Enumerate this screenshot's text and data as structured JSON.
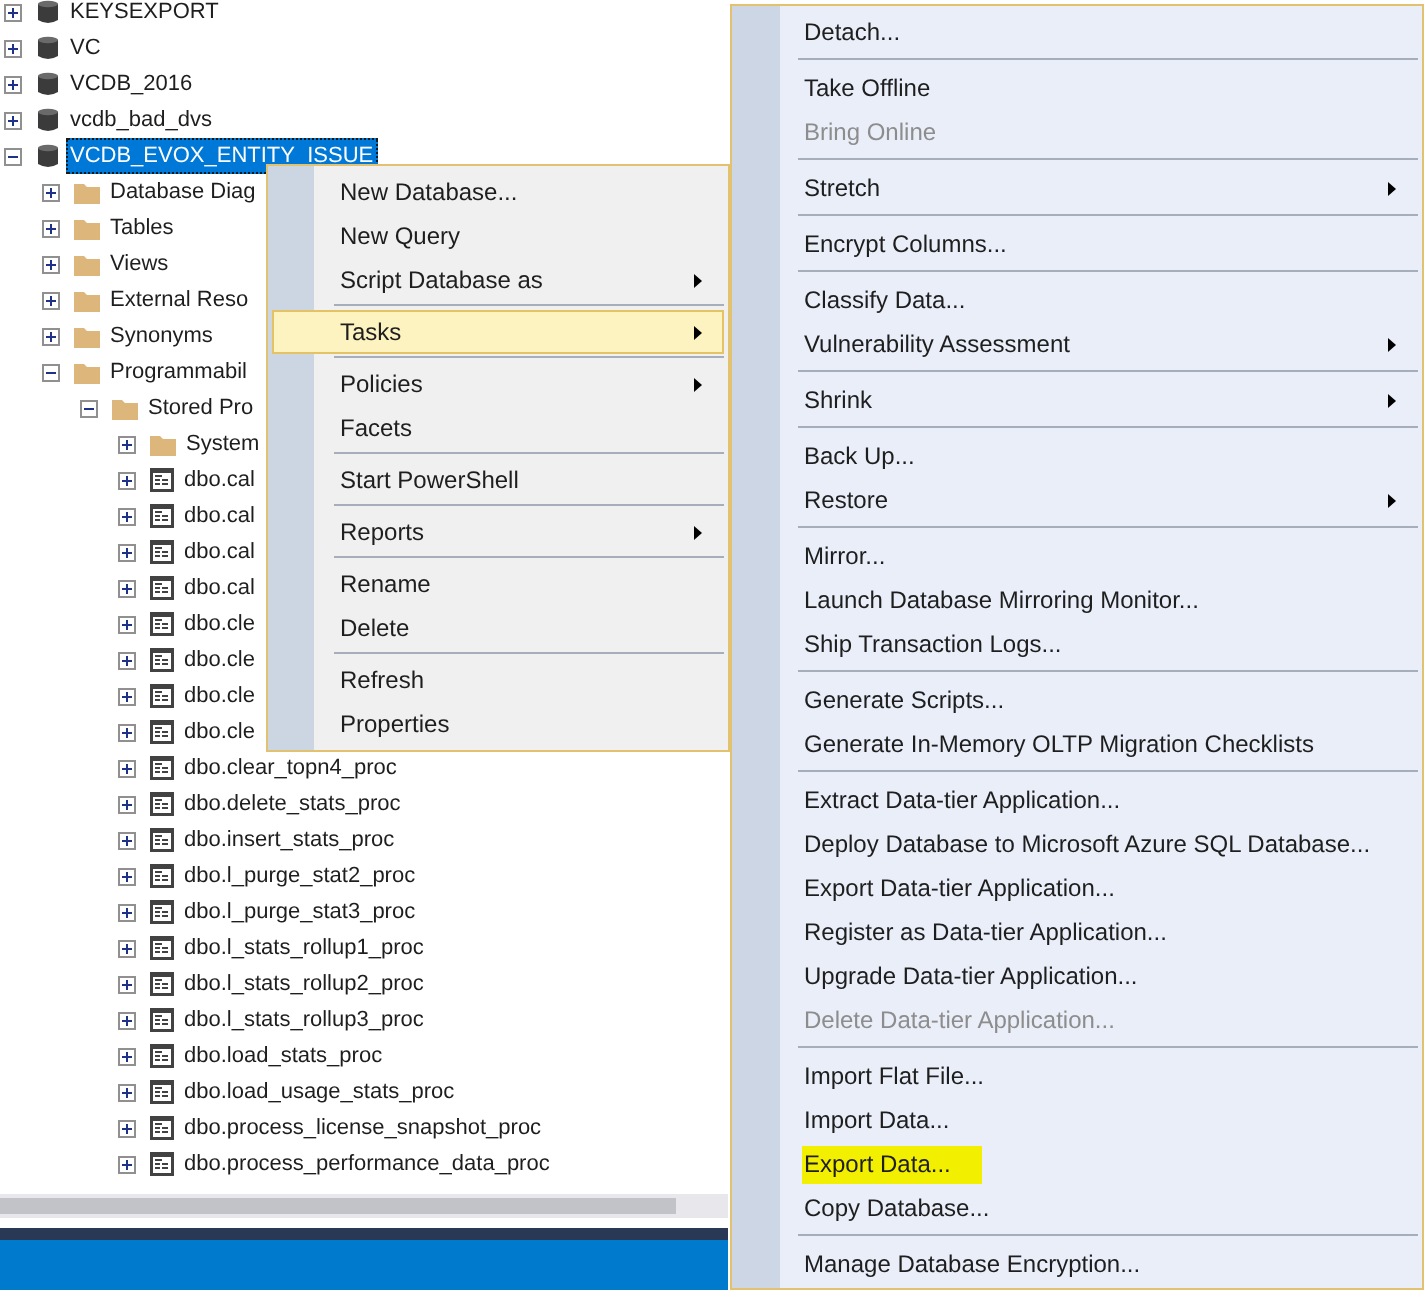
{
  "object_explorer": {
    "tree": [
      {
        "label": "KEYSEXPORT",
        "kind": "database",
        "expanded": false,
        "selected": false
      },
      {
        "label": "VC",
        "kind": "database",
        "expanded": false,
        "selected": false
      },
      {
        "label": "VCDB_2016",
        "kind": "database",
        "expanded": false,
        "selected": false
      },
      {
        "label": "vcdb_bad_dvs",
        "kind": "database",
        "expanded": false,
        "selected": false
      },
      {
        "label": "VCDB_EVOX_ENTITY_ISSUE",
        "kind": "database",
        "expanded": true,
        "selected": true,
        "children": [
          {
            "label": "Database Diag",
            "kind": "folder",
            "expanded": false,
            "selected": false
          },
          {
            "label": "Tables",
            "kind": "folder",
            "expanded": false,
            "selected": false
          },
          {
            "label": "Views",
            "kind": "folder",
            "expanded": false,
            "selected": false
          },
          {
            "label": "External Reso",
            "kind": "folder",
            "expanded": false,
            "selected": false
          },
          {
            "label": "Synonyms",
            "kind": "folder",
            "expanded": false,
            "selected": false
          },
          {
            "label": "Programmabil",
            "kind": "folder",
            "expanded": true,
            "selected": false,
            "children": [
              {
                "label": "Stored Pro",
                "kind": "folder",
                "expanded": true,
                "selected": false,
                "children": [
                  {
                    "label": "System",
                    "kind": "folder",
                    "expanded": false,
                    "selected": false
                  },
                  {
                    "label": "dbo.cal",
                    "kind": "procedure",
                    "expanded": false,
                    "selected": false
                  },
                  {
                    "label": "dbo.cal",
                    "kind": "procedure",
                    "expanded": false,
                    "selected": false
                  },
                  {
                    "label": "dbo.cal",
                    "kind": "procedure",
                    "expanded": false,
                    "selected": false
                  },
                  {
                    "label": "dbo.cal",
                    "kind": "procedure",
                    "expanded": false,
                    "selected": false
                  },
                  {
                    "label": "dbo.cle",
                    "kind": "procedure",
                    "expanded": false,
                    "selected": false
                  },
                  {
                    "label": "dbo.cle",
                    "kind": "procedure",
                    "expanded": false,
                    "selected": false
                  },
                  {
                    "label": "dbo.cle",
                    "kind": "procedure",
                    "expanded": false,
                    "selected": false
                  },
                  {
                    "label": "dbo.cle",
                    "kind": "procedure",
                    "expanded": false,
                    "selected": false
                  },
                  {
                    "label": "dbo.clear_topn4_proc",
                    "kind": "procedure",
                    "expanded": false,
                    "selected": false
                  },
                  {
                    "label": "dbo.delete_stats_proc",
                    "kind": "procedure",
                    "expanded": false,
                    "selected": false
                  },
                  {
                    "label": "dbo.insert_stats_proc",
                    "kind": "procedure",
                    "expanded": false,
                    "selected": false
                  },
                  {
                    "label": "dbo.l_purge_stat2_proc",
                    "kind": "procedure",
                    "expanded": false,
                    "selected": false
                  },
                  {
                    "label": "dbo.l_purge_stat3_proc",
                    "kind": "procedure",
                    "expanded": false,
                    "selected": false
                  },
                  {
                    "label": "dbo.l_stats_rollup1_proc",
                    "kind": "procedure",
                    "expanded": false,
                    "selected": false
                  },
                  {
                    "label": "dbo.l_stats_rollup2_proc",
                    "kind": "procedure",
                    "expanded": false,
                    "selected": false
                  },
                  {
                    "label": "dbo.l_stats_rollup3_proc",
                    "kind": "procedure",
                    "expanded": false,
                    "selected": false
                  },
                  {
                    "label": "dbo.load_stats_proc",
                    "kind": "procedure",
                    "expanded": false,
                    "selected": false
                  },
                  {
                    "label": "dbo.load_usage_stats_proc",
                    "kind": "procedure",
                    "expanded": false,
                    "selected": false
                  },
                  {
                    "label": "dbo.process_license_snapshot_proc",
                    "kind": "procedure",
                    "expanded": false,
                    "selected": false
                  },
                  {
                    "label": "dbo.process_performance_data_proc",
                    "kind": "procedure",
                    "expanded": false,
                    "selected": false
                  }
                ]
              }
            ]
          }
        ]
      }
    ]
  },
  "context_menu": {
    "items": [
      {
        "kind": "item",
        "label": "New Database...",
        "submenu": false,
        "selected": false
      },
      {
        "kind": "item",
        "label": "New Query",
        "submenu": false,
        "selected": false
      },
      {
        "kind": "item",
        "label": "Script Database as",
        "submenu": true,
        "selected": false
      },
      {
        "kind": "separator"
      },
      {
        "kind": "item",
        "label": "Tasks",
        "submenu": true,
        "selected": true
      },
      {
        "kind": "separator"
      },
      {
        "kind": "item",
        "label": "Policies",
        "submenu": true,
        "selected": false
      },
      {
        "kind": "item",
        "label": "Facets",
        "submenu": false,
        "selected": false
      },
      {
        "kind": "separator"
      },
      {
        "kind": "item",
        "label": "Start PowerShell",
        "submenu": false,
        "selected": false
      },
      {
        "kind": "separator"
      },
      {
        "kind": "item",
        "label": "Reports",
        "submenu": true,
        "selected": false
      },
      {
        "kind": "separator"
      },
      {
        "kind": "item",
        "label": "Rename",
        "submenu": false,
        "selected": false
      },
      {
        "kind": "item",
        "label": "Delete",
        "submenu": false,
        "selected": false
      },
      {
        "kind": "separator"
      },
      {
        "kind": "item",
        "label": "Refresh",
        "submenu": false,
        "selected": false
      },
      {
        "kind": "item",
        "label": "Properties",
        "submenu": false,
        "selected": false
      }
    ]
  },
  "tasks_submenu": {
    "items": [
      {
        "kind": "item",
        "label": "Detach...",
        "submenu": false,
        "disabled": false,
        "marked": false
      },
      {
        "kind": "separator"
      },
      {
        "kind": "item",
        "label": "Take Offline",
        "submenu": false,
        "disabled": false,
        "marked": false
      },
      {
        "kind": "item",
        "label": "Bring Online",
        "submenu": false,
        "disabled": true,
        "marked": false
      },
      {
        "kind": "separator"
      },
      {
        "kind": "item",
        "label": "Stretch",
        "submenu": true,
        "disabled": false,
        "marked": false
      },
      {
        "kind": "separator"
      },
      {
        "kind": "item",
        "label": "Encrypt Columns...",
        "submenu": false,
        "disabled": false,
        "marked": false
      },
      {
        "kind": "separator"
      },
      {
        "kind": "item",
        "label": "Classify Data...",
        "submenu": false,
        "disabled": false,
        "marked": false
      },
      {
        "kind": "item",
        "label": "Vulnerability Assessment",
        "submenu": true,
        "disabled": false,
        "marked": false
      },
      {
        "kind": "separator"
      },
      {
        "kind": "item",
        "label": "Shrink",
        "submenu": true,
        "disabled": false,
        "marked": false
      },
      {
        "kind": "separator"
      },
      {
        "kind": "item",
        "label": "Back Up...",
        "submenu": false,
        "disabled": false,
        "marked": false
      },
      {
        "kind": "item",
        "label": "Restore",
        "submenu": true,
        "disabled": false,
        "marked": false
      },
      {
        "kind": "separator"
      },
      {
        "kind": "item",
        "label": "Mirror...",
        "submenu": false,
        "disabled": false,
        "marked": false
      },
      {
        "kind": "item",
        "label": "Launch Database Mirroring Monitor...",
        "submenu": false,
        "disabled": false,
        "marked": false
      },
      {
        "kind": "item",
        "label": "Ship Transaction Logs...",
        "submenu": false,
        "disabled": false,
        "marked": false
      },
      {
        "kind": "separator"
      },
      {
        "kind": "item",
        "label": "Generate Scripts...",
        "submenu": false,
        "disabled": false,
        "marked": false
      },
      {
        "kind": "item",
        "label": "Generate In-Memory OLTP Migration Checklists",
        "submenu": false,
        "disabled": false,
        "marked": false
      },
      {
        "kind": "separator"
      },
      {
        "kind": "item",
        "label": "Extract Data-tier Application...",
        "submenu": false,
        "disabled": false,
        "marked": false
      },
      {
        "kind": "item",
        "label": "Deploy Database to Microsoft Azure SQL Database...",
        "submenu": false,
        "disabled": false,
        "marked": false
      },
      {
        "kind": "item",
        "label": "Export Data-tier Application...",
        "submenu": false,
        "disabled": false,
        "marked": false
      },
      {
        "kind": "item",
        "label": "Register as Data-tier Application...",
        "submenu": false,
        "disabled": false,
        "marked": false
      },
      {
        "kind": "item",
        "label": "Upgrade Data-tier Application...",
        "submenu": false,
        "disabled": false,
        "marked": false
      },
      {
        "kind": "item",
        "label": "Delete Data-tier Application...",
        "submenu": false,
        "disabled": true,
        "marked": false
      },
      {
        "kind": "separator"
      },
      {
        "kind": "item",
        "label": "Import Flat File...",
        "submenu": false,
        "disabled": false,
        "marked": false
      },
      {
        "kind": "item",
        "label": "Import Data...",
        "submenu": false,
        "disabled": false,
        "marked": false
      },
      {
        "kind": "item",
        "label": "Export Data...",
        "submenu": false,
        "disabled": false,
        "marked": true
      },
      {
        "kind": "item",
        "label": "Copy Database...",
        "submenu": false,
        "disabled": false,
        "marked": false
      },
      {
        "kind": "separator"
      },
      {
        "kind": "item",
        "label": "Manage Database Encryption...",
        "submenu": false,
        "disabled": false,
        "marked": false
      }
    ]
  }
}
